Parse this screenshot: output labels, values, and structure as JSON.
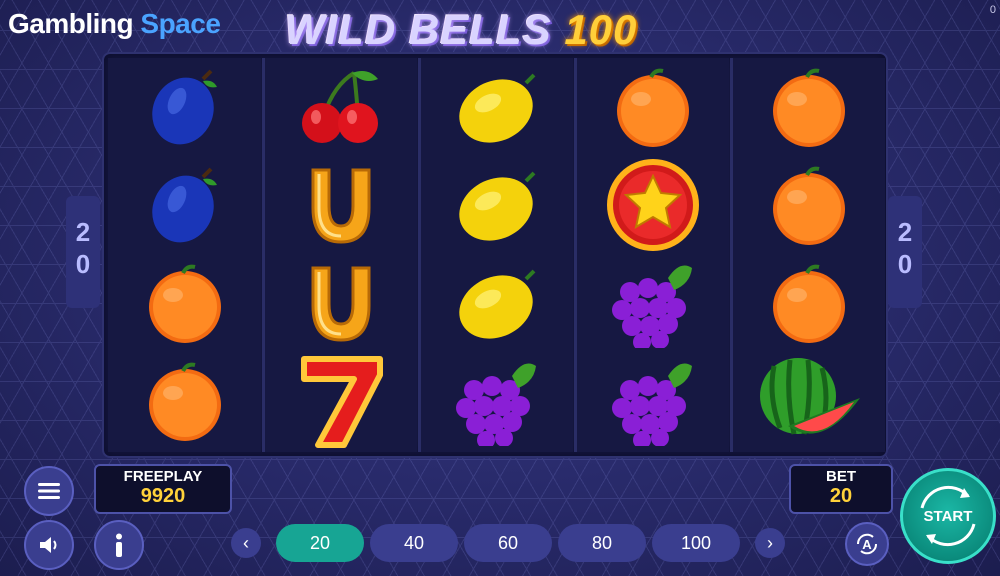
{
  "brand": {
    "part1": "Gambling ",
    "part2": "Space"
  },
  "title": {
    "text": "WILD BELLS ",
    "number": "100"
  },
  "corner_value": "0",
  "paylines": {
    "left": [
      "2",
      "0"
    ],
    "right": [
      "2",
      "0"
    ]
  },
  "reels": [
    [
      "plum-icon",
      "plum-icon",
      "orange-icon",
      "orange-icon"
    ],
    [
      "cherry-icon",
      "horseshoe-icon",
      "horseshoe-icon",
      "seven-icon"
    ],
    [
      "lemon-icon",
      "lemon-icon",
      "lemon-icon",
      "grapes-icon"
    ],
    [
      "orange-icon",
      "star-icon",
      "grapes-icon",
      "grapes-icon"
    ],
    [
      "orange-icon",
      "orange-icon",
      "orange-icon",
      "watermelon-icon"
    ]
  ],
  "freeplay": {
    "label": "FREEPLAY",
    "value": "9920"
  },
  "bet": {
    "label": "BET",
    "value": "20"
  },
  "bet_options": [
    "20",
    "40",
    "60",
    "80",
    "100"
  ],
  "bet_selected": "20",
  "start_label": "START",
  "colors": {
    "accent": "#17a594",
    "reel_bg": "#161842",
    "panel": "#3a3e8f"
  }
}
